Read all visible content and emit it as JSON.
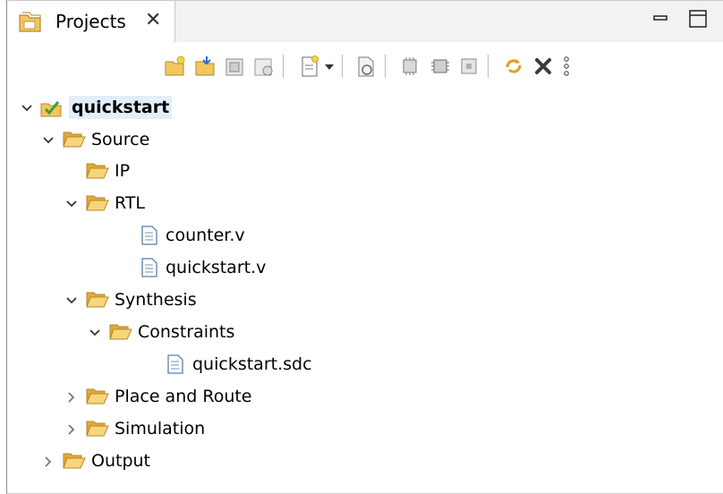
{
  "tab": {
    "title": "Projects",
    "close": "✕"
  },
  "toolbar": {
    "buttons": [
      "new-project-icon",
      "open-project-icon",
      "import-icon",
      "export-icon",
      "new-file-icon",
      "new-file-dropdown-icon",
      "file-settings-icon",
      "run-synthesis-icon",
      "run-place-route-icon",
      "generate-bitstream-icon",
      "refresh-icon",
      "remove-icon",
      "view-menu-icon"
    ]
  },
  "tree": {
    "root": "quickstart",
    "source": "Source",
    "ip": "IP",
    "rtl": "RTL",
    "counter": "counter.v",
    "quickstart_v": "quickstart.v",
    "synthesis": "Synthesis",
    "constraints": "Constraints",
    "quickstart_sdc": "quickstart.sdc",
    "place_route": "Place and Route",
    "simulation": "Simulation",
    "output": "Output"
  },
  "colors": {
    "folder": "#e8b84a",
    "folder_dark": "#b8862a",
    "file": "#5a7fa8",
    "selection": "#e3eefa"
  }
}
